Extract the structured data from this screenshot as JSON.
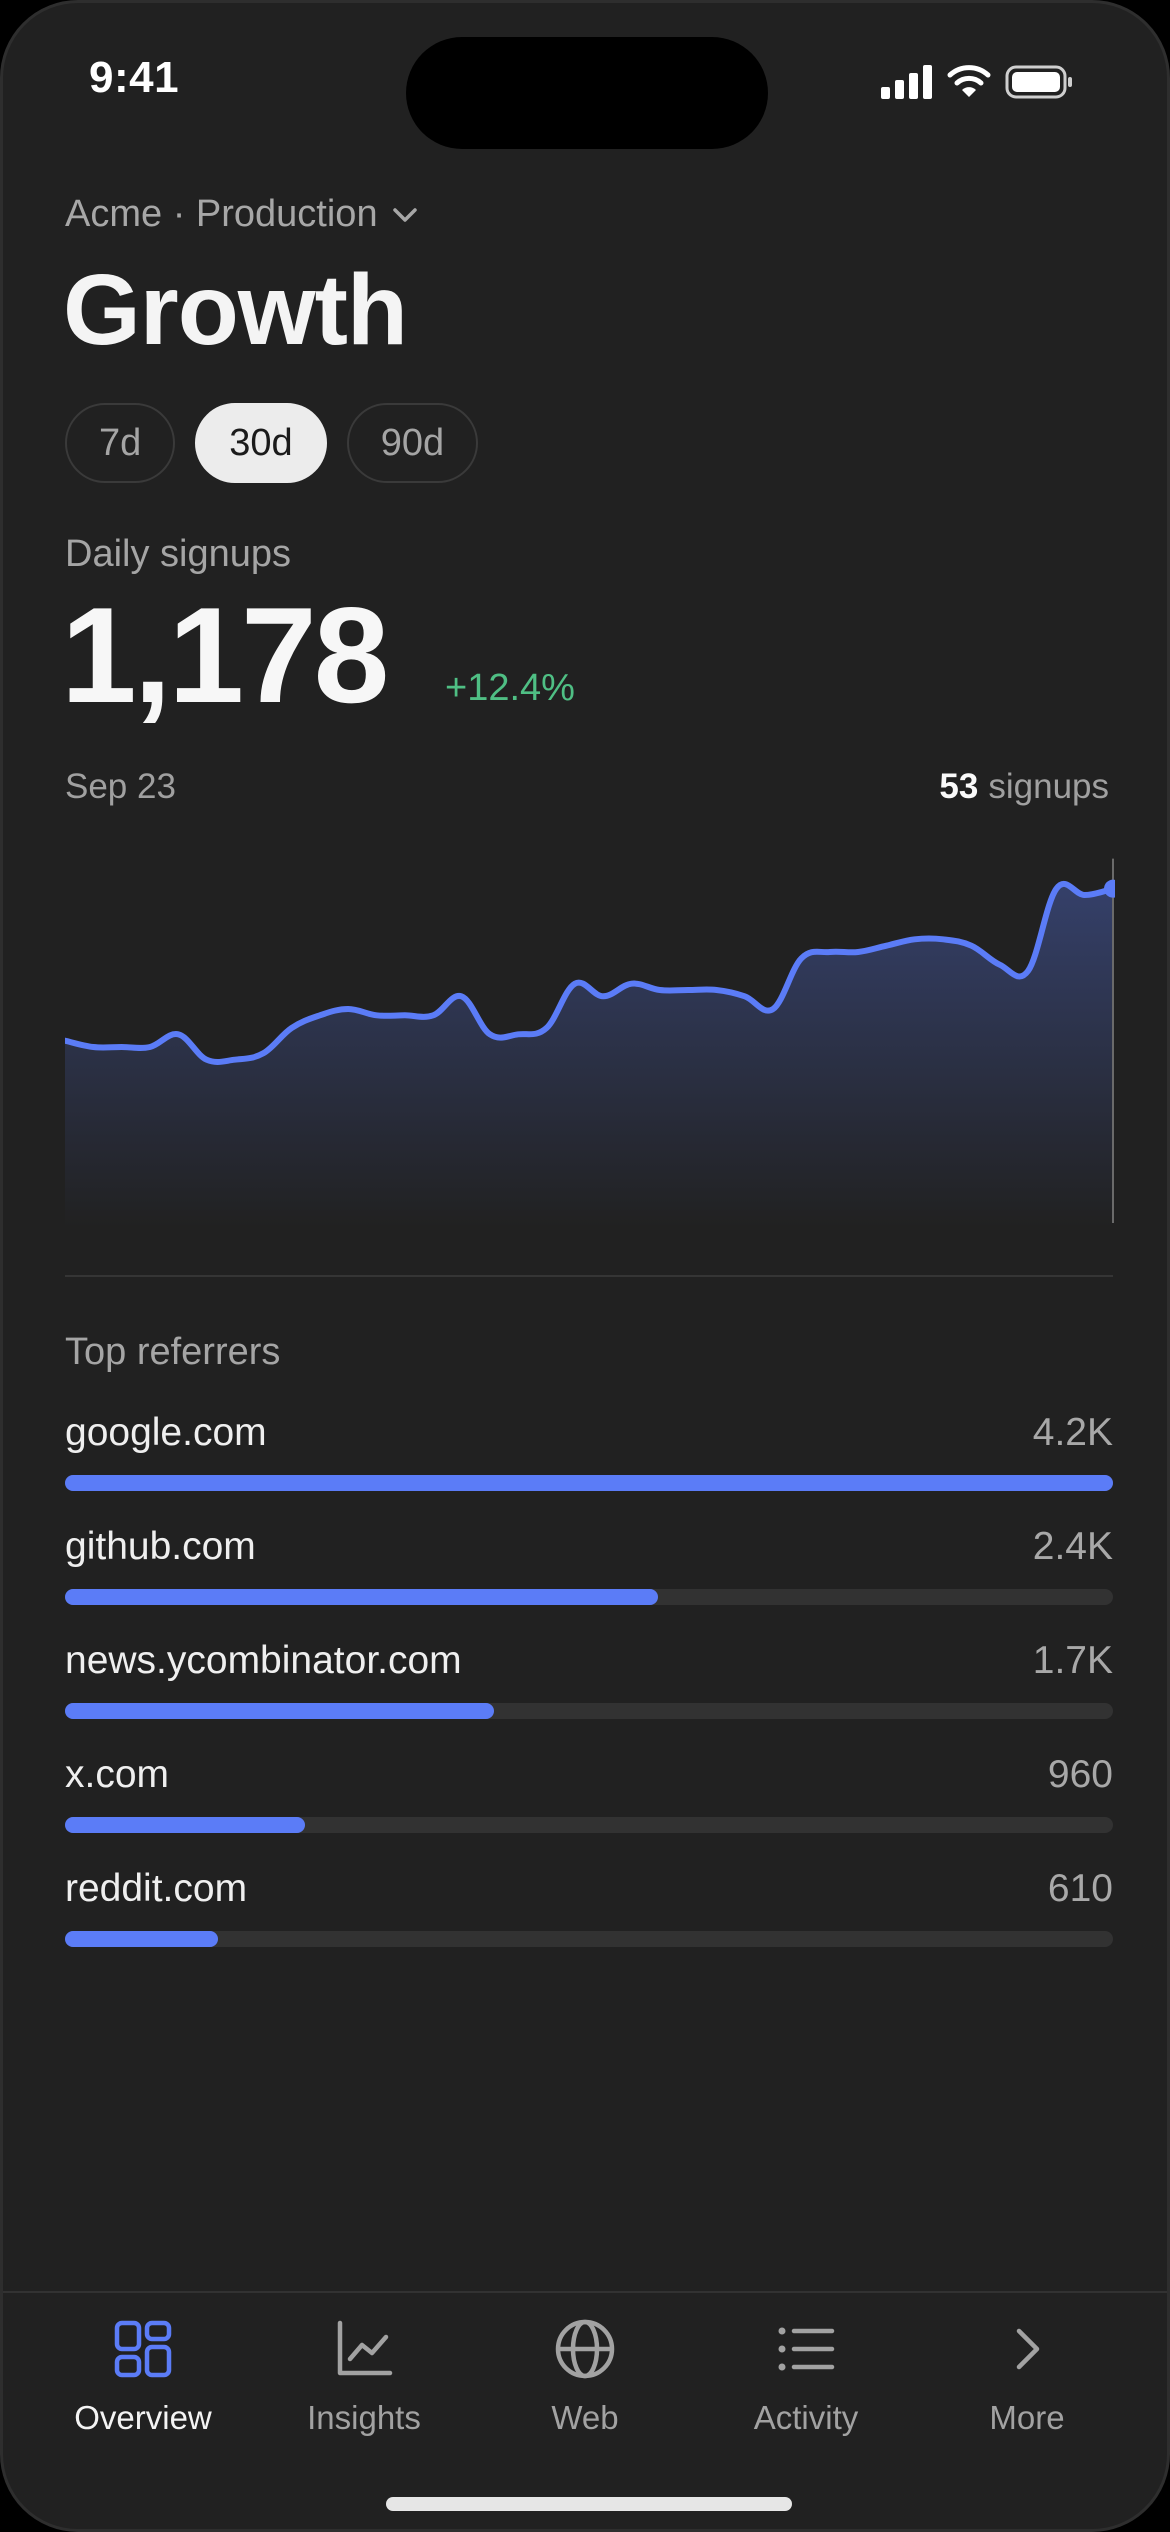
{
  "status_bar": {
    "time": "9:41"
  },
  "header": {
    "project": "Acme · Production",
    "title": "Growth",
    "ranges": [
      {
        "label": "7d",
        "active": false
      },
      {
        "label": "30d",
        "active": true
      },
      {
        "label": "90d",
        "active": false
      }
    ]
  },
  "metric": {
    "label": "Daily signups",
    "value": "1,178",
    "delta": "+12.4%"
  },
  "chart_header": {
    "date": "Sep 23",
    "readout_value": "53",
    "readout_unit": "signups"
  },
  "chart_data": {
    "type": "area",
    "title": "",
    "xlabel": "",
    "ylabel": "",
    "grid": false,
    "legend": "none",
    "ylim": [
      0,
      60
    ],
    "series": [
      {
        "values": [
          28,
          27,
          27,
          27,
          29,
          25,
          25,
          26,
          30,
          32,
          33,
          32,
          32,
          32,
          35,
          29,
          29,
          30,
          37,
          35,
          37,
          36,
          36,
          36,
          35,
          33,
          41,
          42,
          42,
          43,
          44,
          44,
          43,
          40,
          39,
          52,
          51,
          52
        ]
      }
    ],
    "highlight_index": 37,
    "color": "#5b7cf7"
  },
  "referrers": {
    "title": "Top referrers",
    "items": [
      {
        "name": "google.com",
        "value": "4.2K",
        "share": 1.0
      },
      {
        "name": "github.com",
        "value": "2.4K",
        "share": 0.566
      },
      {
        "name": "news.ycombinator.com",
        "value": "1.7K",
        "share": 0.409
      },
      {
        "name": "x.com",
        "value": "960",
        "share": 0.229
      },
      {
        "name": "reddit.com",
        "value": "610",
        "share": 0.146
      }
    ]
  },
  "tabs": [
    {
      "label": "Overview",
      "icon": "grid-icon",
      "active": true
    },
    {
      "label": "Insights",
      "icon": "line-chart-icon",
      "active": false
    },
    {
      "label": "Web",
      "icon": "globe-icon",
      "active": false
    },
    {
      "label": "Activity",
      "icon": "list-icon",
      "active": false
    },
    {
      "label": "More",
      "icon": "chevron-right-icon",
      "active": false
    }
  ],
  "colors": {
    "accent": "#5b7cf7",
    "positive": "#4fbf84",
    "background": "#212121"
  }
}
